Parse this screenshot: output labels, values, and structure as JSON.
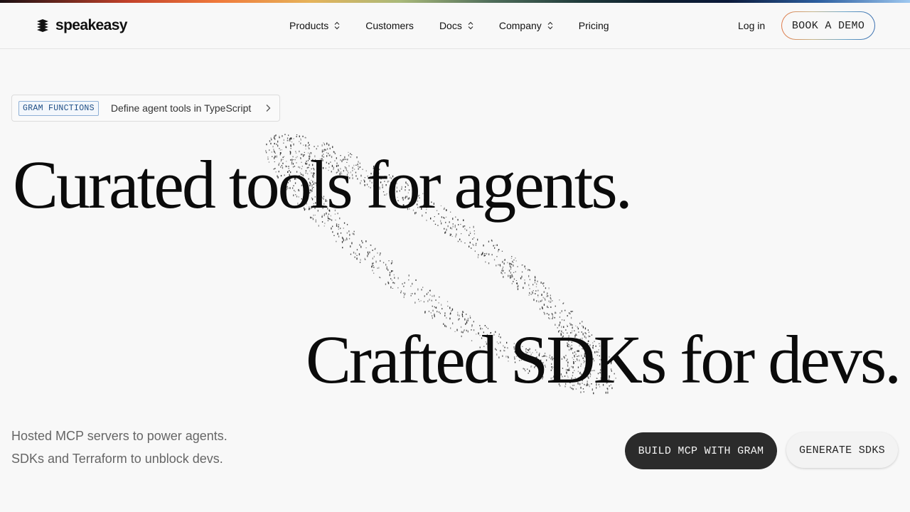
{
  "brand": {
    "name": "speakeasy",
    "logo_icon": "stacked-layers-icon"
  },
  "nav": {
    "items": [
      {
        "label": "Products",
        "has_dropdown": true
      },
      {
        "label": "Customers",
        "has_dropdown": false
      },
      {
        "label": "Docs",
        "has_dropdown": true
      },
      {
        "label": "Company",
        "has_dropdown": true
      },
      {
        "label": "Pricing",
        "has_dropdown": false
      }
    ],
    "login_label": "Log in",
    "demo_label": "BOOK A DEMO"
  },
  "announcement": {
    "tag": "GRAM FUNCTIONS",
    "text": "Define agent tools in TypeScript",
    "icon": "chevron-right-icon"
  },
  "hero": {
    "headline_1": "Curated tools for agents.",
    "headline_2": "Crafted SDKs for devs.",
    "tagline_1": "Hosted MCP servers to power agents.",
    "tagline_2": "SDKs and Terraform to unblock devs.",
    "primary_cta": "BUILD MCP WITH GRAM",
    "secondary_cta": "GENERATE SDKS"
  },
  "colors": {
    "background": "#f8f8f8",
    "primary_button": "#2b2b2b",
    "tag_blue": "#1e4e86",
    "text_muted": "#666666"
  }
}
